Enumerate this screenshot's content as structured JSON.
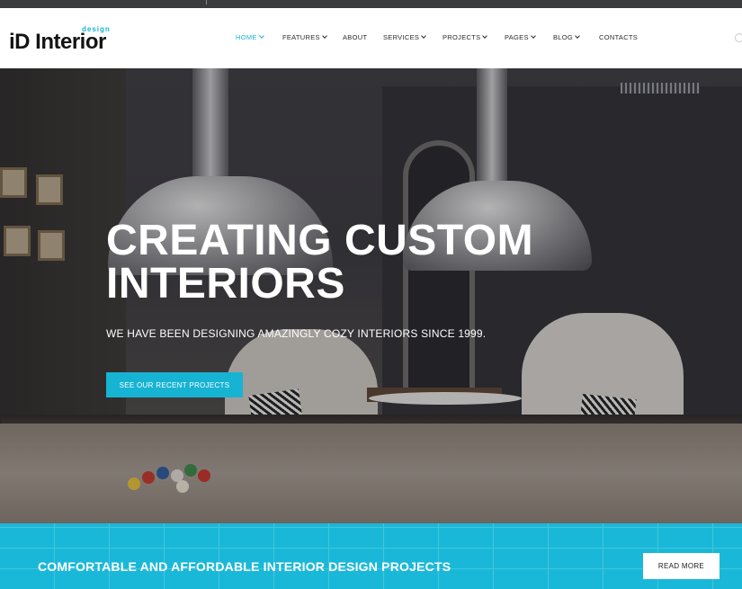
{
  "brand": {
    "logo_text": "iD Interior",
    "logo_sub": "design",
    "accent_color": "#17b3d3"
  },
  "nav": {
    "items": [
      {
        "label": "HOME",
        "has_dropdown": true,
        "active": true
      },
      {
        "label": "FEATURES",
        "has_dropdown": true,
        "active": false
      },
      {
        "label": "ABOUT",
        "has_dropdown": false,
        "active": false
      },
      {
        "label": "SERVICES",
        "has_dropdown": true,
        "active": false
      },
      {
        "label": "PROJECTS",
        "has_dropdown": true,
        "active": false
      },
      {
        "label": "PAGES",
        "has_dropdown": true,
        "active": false
      },
      {
        "label": "BLOG",
        "has_dropdown": true,
        "active": false
      },
      {
        "label": "CONTACTS",
        "has_dropdown": false,
        "active": false
      }
    ],
    "search_icon": "search-icon"
  },
  "hero": {
    "title": "CREATING CUSTOM INTERIORS",
    "subtitle": "WE HAVE BEEN DESIGNING AMAZINGLY COZY INTERIORS SINCE 1999.",
    "cta_label": "SEE OUR RECENT PROJECTS"
  },
  "band": {
    "text": "COMFORTABLE AND AFFORDABLE INTERIOR DESIGN PROJECTS",
    "button_label": "READ MORE",
    "color": "#1ab8d8"
  }
}
